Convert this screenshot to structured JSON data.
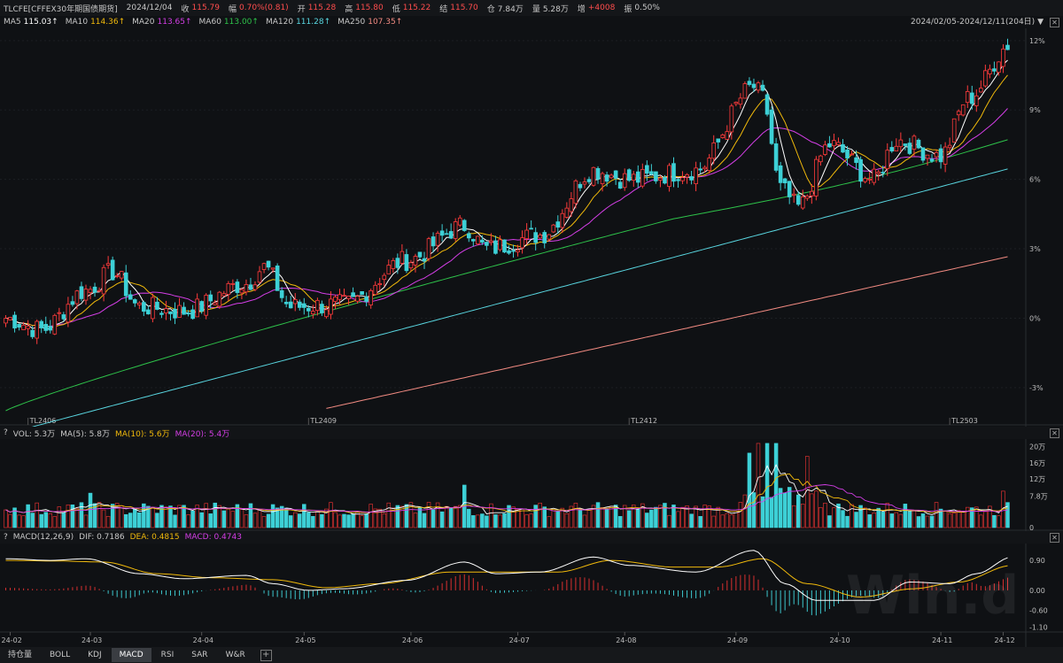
{
  "info": {
    "symbol": "TLCFE[CFFEX30年期国债期货]",
    "date": "2024/12/04",
    "close_label": "收",
    "close": "115.79",
    "change_label": "幅",
    "change": "0.70%(0.81)",
    "open_label": "开",
    "open": "115.28",
    "high_label": "高",
    "high": "115.80",
    "low_label": "低",
    "low": "115.22",
    "settle_label": "结",
    "settle": "115.70",
    "oi_label": "仓",
    "oi": "7.84万",
    "vol_label": "量",
    "vol": "5.28万",
    "oichg_label": "增",
    "oichg": "+4008",
    "amp_label": "振",
    "amp": "0.50%"
  },
  "ma_legend": [
    {
      "label": "MA5",
      "value": "115.03↑",
      "color": "#ffffff"
    },
    {
      "label": "MA10",
      "value": "114.36↑",
      "color": "#f0b90b"
    },
    {
      "label": "MA20",
      "value": "113.65↑",
      "color": "#d43ee6"
    },
    {
      "label": "MA60",
      "value": "113.00↑",
      "color": "#2ec24a"
    },
    {
      "label": "MA120",
      "value": "111.28↑",
      "color": "#59d6e0"
    },
    {
      "label": "MA250",
      "value": "107.35↑",
      "color": "#f28b82"
    }
  ],
  "range_label": "2024/02/05-2024/12/11(204日)",
  "vol_legend": {
    "prefix": "?",
    "vol": "VOL: 5.3万",
    "ma5": "MA(5): 5.8万",
    "ma10": "MA(10): 5.6万",
    "ma20": "MA(20): 5.4万"
  },
  "macd_legend": {
    "prefix": "?",
    "name": "MACD(12,26,9)",
    "dif": "DIF: 0.7186",
    "dea": "DEA: 0.4815",
    "macd": "MACD: 0.4743"
  },
  "tabs": [
    "持仓量",
    "BOLL",
    "KDJ",
    "MACD",
    "RSI",
    "SAR",
    "W&R"
  ],
  "active_tab": "MACD",
  "close_icon": "close-icon",
  "watermark": "Win.d",
  "chart_data": [
    {
      "type": "candlestick",
      "y_axis_ticks": [
        "12%",
        "9%",
        "6%",
        "3%",
        "0%",
        "-3%"
      ],
      "y_axis_values": [
        12,
        9,
        6,
        3,
        0,
        -3
      ],
      "contract_labels": [
        "TL2406",
        "TL2409",
        "TL2412",
        "TL2503"
      ],
      "contract_label_index": [
        5,
        68,
        140,
        212
      ],
      "n_bars": 226,
      "close_pct_anchors": [
        [
          0,
          0
        ],
        [
          8,
          -0.5
        ],
        [
          18,
          1.2
        ],
        [
          24,
          2.0
        ],
        [
          30,
          0.5
        ],
        [
          40,
          0.3
        ],
        [
          54,
          1.5
        ],
        [
          58,
          2.2
        ],
        [
          64,
          0.5
        ],
        [
          76,
          0.6
        ],
        [
          90,
          2.5
        ],
        [
          103,
          4.0
        ],
        [
          108,
          3.0
        ],
        [
          120,
          3.6
        ],
        [
          132,
          6.4
        ],
        [
          140,
          6.0
        ],
        [
          155,
          6.4
        ],
        [
          168,
          10.0
        ],
        [
          170,
          9.5
        ],
        [
          174,
          5.6
        ],
        [
          178,
          4.8
        ],
        [
          185,
          7.5
        ],
        [
          195,
          6.0
        ],
        [
          200,
          7.7
        ],
        [
          210,
          7.0
        ],
        [
          216,
          9.5
        ],
        [
          226,
          11.9
        ]
      ],
      "colors": {
        "up": "#ff3b3b",
        "down": "#3dd0d6"
      },
      "ma_curves": [
        {
          "name": "MA5",
          "color": "#ffffff"
        },
        {
          "name": "MA10",
          "color": "#f0b90b"
        },
        {
          "name": "MA20",
          "color": "#d43ee6"
        },
        {
          "name": "MA60",
          "color": "#2ec24a"
        },
        {
          "name": "MA120",
          "color": "#59d6e0"
        },
        {
          "name": "MA250",
          "color": "#f28b82"
        }
      ]
    },
    {
      "type": "bar",
      "name": "VOL",
      "y_axis_ticks": [
        "20万",
        "16万",
        "12万",
        "7.8万",
        "0"
      ],
      "y_axis_values": [
        20,
        16,
        12,
        7.8,
        0
      ],
      "unit": "万",
      "base_level": 4.5,
      "spikes": [
        [
          19,
          8.5
        ],
        [
          103,
          10.5
        ],
        [
          167,
          11.5
        ],
        [
          169,
          20.8
        ],
        [
          171,
          16.5
        ],
        [
          173,
          14.0
        ],
        [
          180,
          11.0
        ],
        [
          224,
          9.0
        ]
      ]
    },
    {
      "type": "bar",
      "name": "MACD",
      "y_axis_ticks": [
        "0.90",
        "0.00",
        "-0.60",
        "-1.10"
      ],
      "y_axis_values": [
        0.9,
        0.0,
        -0.6,
        -1.1
      ],
      "x_axis_ticks": [
        "24-02",
        "24-03",
        "24-04",
        "24-05",
        "24-06",
        "24-07",
        "24-08",
        "24-09",
        "24-10",
        "24-11",
        "24-12"
      ],
      "dif_anchors": [
        [
          0,
          0.95
        ],
        [
          10,
          0.9
        ],
        [
          18,
          0.95
        ],
        [
          30,
          0.5
        ],
        [
          40,
          0.35
        ],
        [
          54,
          0.45
        ],
        [
          60,
          0.2
        ],
        [
          68,
          0.0
        ],
        [
          76,
          0.05
        ],
        [
          90,
          0.3
        ],
        [
          103,
          0.85
        ],
        [
          110,
          0.5
        ],
        [
          120,
          0.55
        ],
        [
          132,
          1.0
        ],
        [
          140,
          0.75
        ],
        [
          155,
          0.55
        ],
        [
          168,
          1.2
        ],
        [
          175,
          0.2
        ],
        [
          182,
          -0.3
        ],
        [
          195,
          -0.3
        ],
        [
          203,
          0.25
        ],
        [
          212,
          0.2
        ],
        [
          218,
          0.5
        ],
        [
          226,
          1.0
        ]
      ],
      "dea_anchors": [
        [
          0,
          0.9
        ],
        [
          12,
          0.88
        ],
        [
          22,
          0.85
        ],
        [
          34,
          0.5
        ],
        [
          46,
          0.38
        ],
        [
          60,
          0.32
        ],
        [
          72,
          0.08
        ],
        [
          84,
          0.2
        ],
        [
          100,
          0.55
        ],
        [
          112,
          0.55
        ],
        [
          124,
          0.55
        ],
        [
          136,
          0.9
        ],
        [
          150,
          0.7
        ],
        [
          160,
          0.7
        ],
        [
          170,
          0.95
        ],
        [
          180,
          0.2
        ],
        [
          192,
          -0.2
        ],
        [
          204,
          0.05
        ],
        [
          214,
          0.25
        ],
        [
          226,
          0.75
        ]
      ],
      "colors": {
        "dif": "#ffffff",
        "dea": "#f0b90b",
        "pos": "#d93030",
        "neg": "#3dc6cc"
      }
    }
  ]
}
